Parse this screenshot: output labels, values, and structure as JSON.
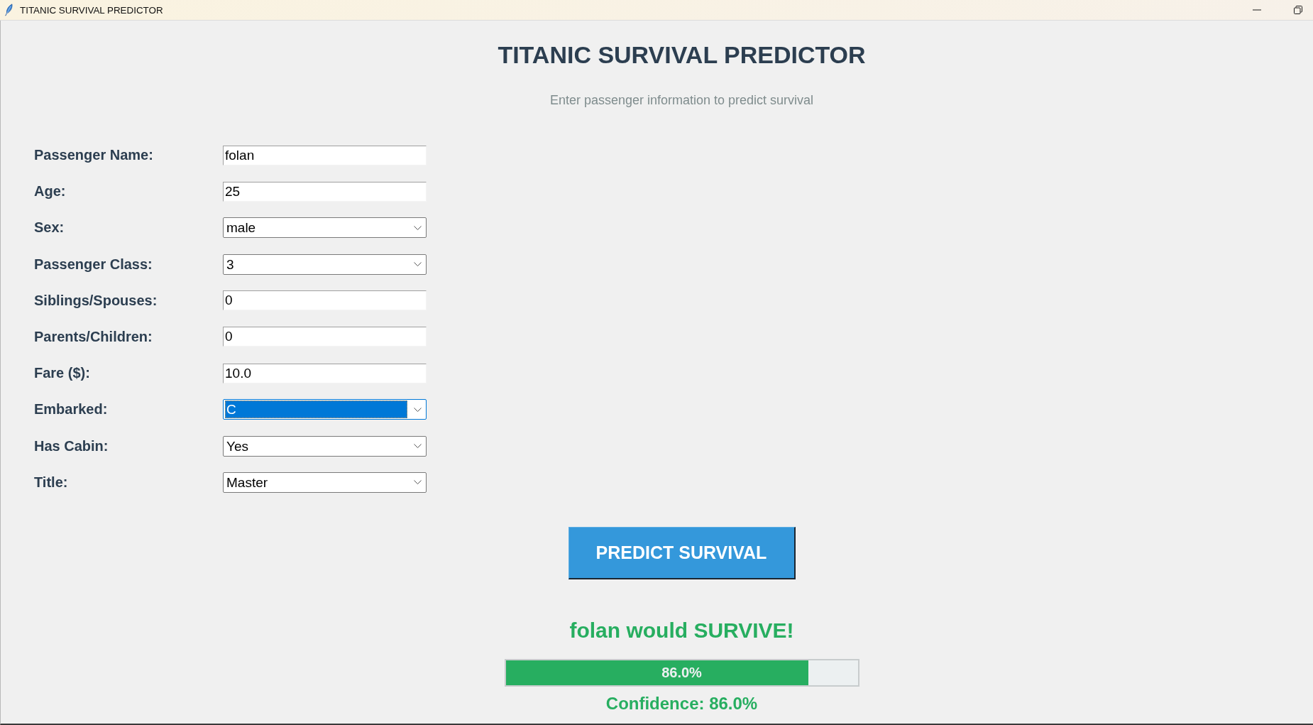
{
  "window": {
    "title": "TITANIC SURVIVAL PREDICTOR"
  },
  "header": {
    "title": "TITANIC SURVIVAL PREDICTOR",
    "subtitle": "Enter passenger information to predict survival"
  },
  "form": {
    "fields": [
      {
        "label": "Passenger Name:",
        "kind": "entry",
        "value": "folan",
        "focused": false
      },
      {
        "label": "Age:",
        "kind": "entry",
        "value": "25",
        "focused": false
      },
      {
        "label": "Sex:",
        "kind": "combobox",
        "value": "male",
        "focused": false
      },
      {
        "label": "Passenger Class:",
        "kind": "combobox",
        "value": "3",
        "focused": false
      },
      {
        "label": "Siblings/Spouses:",
        "kind": "entry",
        "value": "0",
        "focused": false
      },
      {
        "label": "Parents/Children:",
        "kind": "entry",
        "value": "0",
        "focused": false
      },
      {
        "label": "Fare ($):",
        "kind": "entry",
        "value": "10.0",
        "focused": false
      },
      {
        "label": "Embarked:",
        "kind": "combobox",
        "value": "C",
        "focused": true
      },
      {
        "label": "Has Cabin:",
        "kind": "combobox",
        "value": "Yes",
        "focused": false
      },
      {
        "label": "Title:",
        "kind": "combobox",
        "value": "Master",
        "focused": false
      }
    ]
  },
  "predict_button": {
    "label": "PREDICT SURVIVAL"
  },
  "result": {
    "message": "folan would SURVIVE!",
    "survived": true,
    "confidence_bar": {
      "level": 0.86,
      "reading": "86.0%"
    },
    "confidence": "Confidence: 86.0%"
  }
}
